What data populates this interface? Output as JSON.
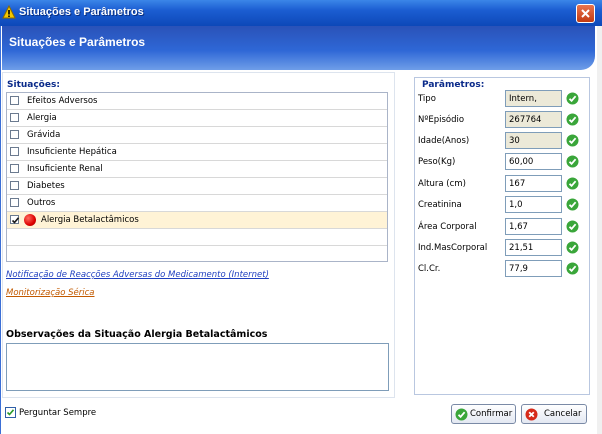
{
  "window": {
    "title": "Situações e Parâmetros",
    "header": "Situações e Parâmetros"
  },
  "situacoes": {
    "heading": "Situações:",
    "items": [
      {
        "label": "Efeitos Adversos",
        "checked": false
      },
      {
        "label": "Alergia",
        "checked": false
      },
      {
        "label": "Grávida",
        "checked": false
      },
      {
        "label": "Insuficiente Hepática",
        "checked": false
      },
      {
        "label": "Insuficiente Renal",
        "checked": false
      },
      {
        "label": "Diabetes",
        "checked": false
      },
      {
        "label": "Outros",
        "checked": false
      },
      {
        "label": "Alergia Betalactâmicos",
        "checked": true
      }
    ]
  },
  "links": {
    "notificacao": "Notificação de Reacções Adversas do Medicamento (Internet)",
    "monitorizacao": "Monitorização Sérica"
  },
  "observacoes": {
    "title": "Observações da Situação Alergia Betalactâmicos",
    "value": ""
  },
  "parametros": {
    "heading": "Parâmetros:",
    "items": [
      {
        "label": "Tipo",
        "value": "Intern,",
        "readonly": true
      },
      {
        "label": "NºEpisódio",
        "value": "267764",
        "readonly": true
      },
      {
        "label": "Idade(Anos)",
        "value": "30",
        "readonly": true
      },
      {
        "label": "Peso(Kg)",
        "value": "60,00",
        "readonly": false
      },
      {
        "label": "Altura (cm)",
        "value": "167",
        "readonly": false
      },
      {
        "label": "Creatinina",
        "value": "1,0",
        "readonly": false
      },
      {
        "label": "Área Corporal",
        "value": "1,67",
        "readonly": false
      },
      {
        "label": "Ind.MasCorporal",
        "value": "21,51",
        "readonly": false
      },
      {
        "label": "Cl.Cr.",
        "value": "77,9",
        "readonly": false
      }
    ]
  },
  "footer": {
    "perguntar_label": "Perguntar Sempre",
    "perguntar_checked": true,
    "confirmar_label": "Confirmar",
    "cancelar_label": "Cancelar"
  },
  "colors": {
    "title_blue": "#1b5dd1",
    "link_blue": "#1f3fbf",
    "link_orange": "#c25a00",
    "ok_green": "#3aa63a",
    "cancel_red": "#d62a1a"
  }
}
